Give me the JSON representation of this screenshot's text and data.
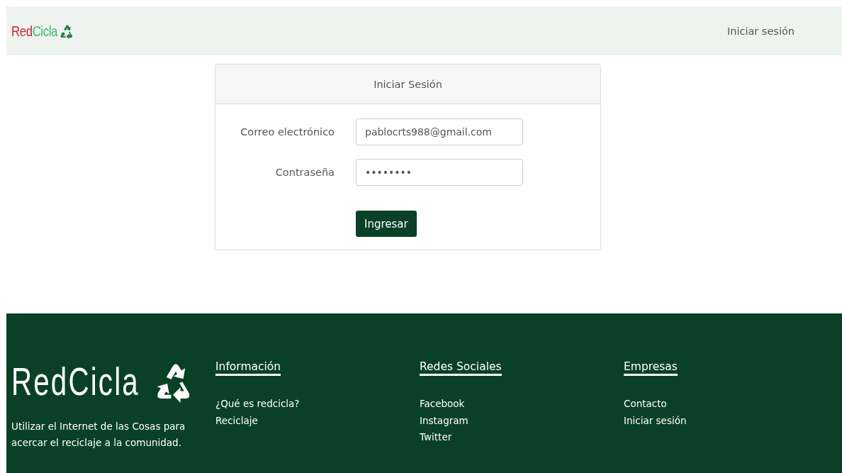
{
  "navbar": {
    "logo": [
      {
        "text": "Red",
        "color": "#c8272e"
      },
      {
        "text": "Cicla",
        "color": "#3dba6c"
      }
    ],
    "links": [
      {
        "label": "Iniciar sesión"
      }
    ]
  },
  "login_card": {
    "title": "Iniciar Sesión",
    "fields": [
      {
        "label": "Correo electrónico",
        "value": "pablocrts988@gmail.com"
      },
      {
        "label": "Contraseña",
        "value": "••••••••"
      }
    ],
    "submit": "Ingresar"
  },
  "footer": {
    "logo": "RedCicla",
    "tagline": "Utilizar el Internet de las Cosas para acercar el reciclaje a la comunidad.",
    "columns": [
      {
        "heading": "Información",
        "links": [
          "¿Qué es redcicla?",
          "Reciclaje"
        ]
      },
      {
        "heading": "Redes Sociales",
        "links": [
          "Facebook",
          "Instagram",
          "Twitter"
        ]
      },
      {
        "heading": "Empresas",
        "links": [
          "Contacto",
          "Iniciar sesión"
        ]
      }
    ]
  }
}
